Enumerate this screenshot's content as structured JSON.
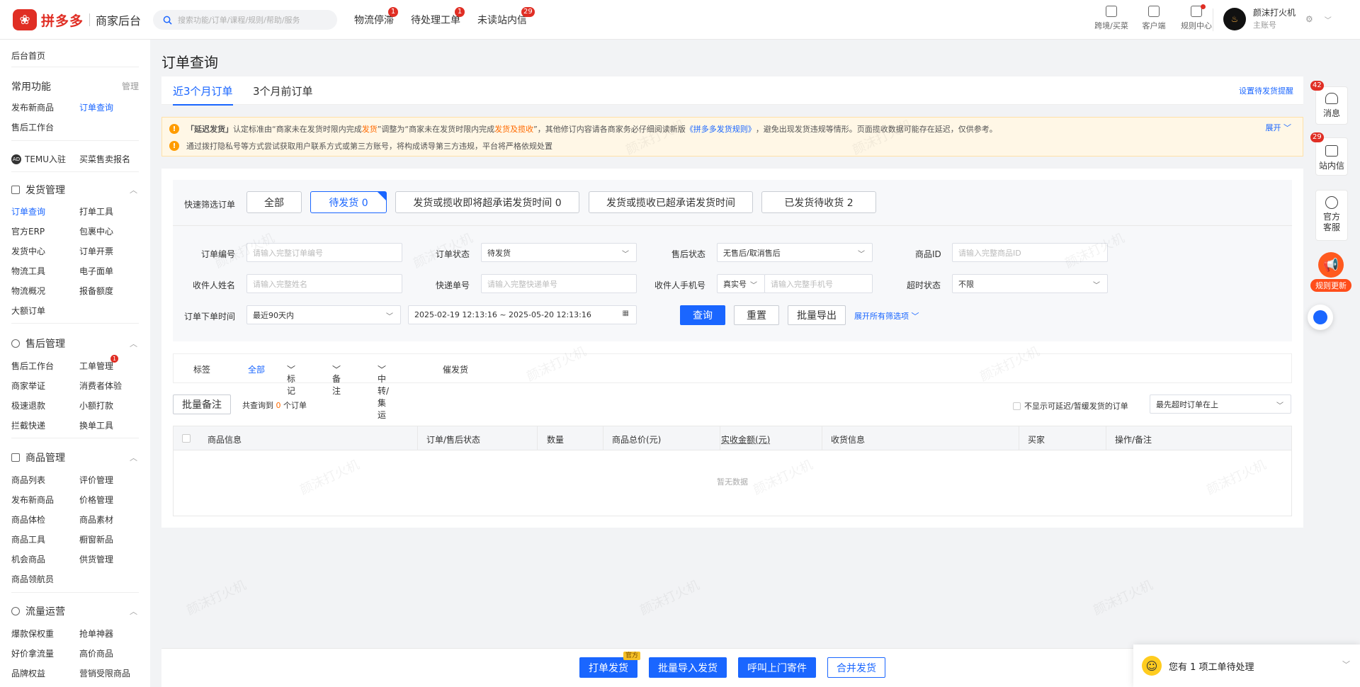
{
  "header": {
    "logo_text": "拼多多",
    "logo_sub": "商家后台",
    "search_placeholder": "搜索功能/订单/课程/规则/帮助/服务",
    "nav": [
      {
        "label": "物流停滞",
        "badge": "1"
      },
      {
        "label": "待处理工单",
        "badge": "1"
      },
      {
        "label": "未读站内信",
        "badge": "29"
      }
    ],
    "icons": [
      "跨境/买菜",
      "客户端",
      "规则中心"
    ],
    "user_name": "颜沫打火机",
    "user_role": "主账号",
    "avatar_text": "♨"
  },
  "sidebar": {
    "home": "后台首页",
    "common": {
      "title": "常用功能",
      "manage": "管理",
      "items": [
        "发布新商品",
        "订单查询",
        "售后工作台"
      ]
    },
    "temu": {
      "icon": "AD",
      "label": "TEMU入驻",
      "other": "买菜售卖报名"
    },
    "shipping": {
      "title": "发货管理",
      "items": [
        "订单查询",
        "打单工具",
        "官方ERP",
        "包裹中心",
        "发货中心",
        "订单开票",
        "物流工具",
        "电子面单",
        "物流概况",
        "报备额度",
        "大额订单"
      ]
    },
    "aftersale": {
      "title": "售后管理",
      "items": [
        "售后工作台",
        "工单管理",
        "商家举证",
        "消费者体验",
        "极速退款",
        "小额打款",
        "拦截快递",
        "换单工具"
      ],
      "badge": "1"
    },
    "goods": {
      "title": "商品管理",
      "items": [
        "商品列表",
        "评价管理",
        "发布新商品",
        "价格管理",
        "商品体检",
        "商品素材",
        "商品工具",
        "橱窗新品",
        "机会商品",
        "供货管理",
        "商品领航员"
      ]
    },
    "traffic": {
      "title": "流量运营",
      "items": [
        "爆款保权重",
        "抢单神器",
        "好价拿流量",
        "高价商品",
        "品牌权益",
        "营销受限商品"
      ]
    }
  },
  "page": {
    "title": "订单查询",
    "tabs": [
      "近3个月订单",
      "3个月前订单"
    ],
    "reminder_link": "设置待发货提醒",
    "notice": {
      "line1_bold": "「延迟发货」",
      "line1_a": "认定标准由“商家未在发货时限内完成",
      "line1_hl1": "发货",
      "line1_b": "”调整为“商家未在发货时限内完成",
      "line1_hl2": "发货及揽收",
      "line1_c": "”，其他修订内容请各商家务必仔细阅读新版",
      "line1_link": "《拼多多发货规则》",
      "line1_d": "，避免出现发货违规等情形。页面揽收数据可能存在延迟，仅供参考。",
      "line2": "通过拨打隐私号等方式尝试获取用户联系方式或第三方账号，将构成诱导第三方违规，平台将严格依规处置",
      "expand": "展开"
    },
    "quick": {
      "label": "快速筛选订单",
      "buttons": [
        "全部",
        "待发货 0",
        "发货或揽收即将超承诺发货时间 0",
        "发货或揽收已超承诺发货时间",
        "已发货待收货 2"
      ]
    },
    "filters": {
      "order_no": {
        "label": "订单编号",
        "placeholder": "请输入完整订单编号"
      },
      "status": {
        "label": "订单状态",
        "value": "待发货"
      },
      "aftersale": {
        "label": "售后状态",
        "value": "无售后/取消售后"
      },
      "goods_id": {
        "label": "商品ID",
        "placeholder": "请输入完整商品ID"
      },
      "receiver": {
        "label": "收件人姓名",
        "placeholder": "请输入完整姓名"
      },
      "express": {
        "label": "快递单号",
        "placeholder": "请输入完整快递单号"
      },
      "phone": {
        "label": "收件人手机号",
        "type": "真实号",
        "placeholder": "请输入完整手机号"
      },
      "timeout": {
        "label": "超时状态",
        "value": "不限"
      },
      "time": {
        "label": "订单下单时间",
        "range": "最近90天内",
        "dates": "2025-02-19 12:13:16 ~ 2025-05-20 12:13:16"
      },
      "search": "查询",
      "reset": "重置",
      "export": "批量导出",
      "more": "展开所有筛选项"
    },
    "tags": {
      "label": "标签",
      "items": [
        "全部",
        "标记",
        "备注",
        "中转/集运",
        "催发货"
      ]
    },
    "batch_note": "批量备注",
    "result_a": "共查询到",
    "result_count": "0",
    "result_b": "个订单",
    "hide_delay": "不显示可延迟/暂缓发货的订单",
    "sort": "最先超时订单在上",
    "table": {
      "headers": [
        "商品信息",
        "订单/售后状态",
        "数量",
        "商品总价(元)",
        "实收金额(元)",
        "收货信息",
        "买家",
        "操作/备注"
      ],
      "empty": "暂无数据"
    }
  },
  "bottom": {
    "buttons": [
      "打单发货",
      "批量导入发货",
      "呼叫上门寄件",
      "合并发货"
    ],
    "official": "官方",
    "pending": "您有 1 项工单待处理"
  },
  "rightbar": [
    {
      "label": "消息",
      "badge": "42"
    },
    {
      "label": "站内信",
      "badge": "29"
    },
    {
      "label": "官方客服"
    },
    {
      "label": "规则更新"
    }
  ],
  "watermark": "颜沫打火机"
}
